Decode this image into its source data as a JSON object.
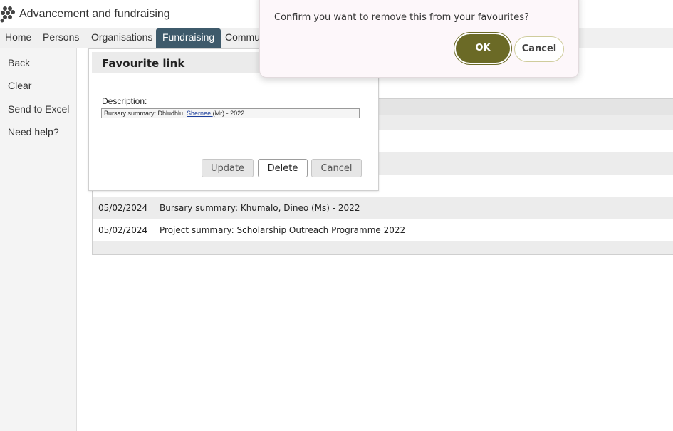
{
  "app": {
    "title": "Advancement and fundraising"
  },
  "nav": {
    "items": [
      "Home",
      "Persons",
      "Organisations",
      "Fundraising",
      "Commu"
    ],
    "active": "Fundraising"
  },
  "sidebar": {
    "items": [
      "Back",
      "Clear",
      "Send to Excel",
      "Need help?"
    ]
  },
  "favourites_table": {
    "rows": [
      {
        "date": "05/02/2024",
        "description": "Bursary summary: Khumalo, Dineo (Ms) - 2022"
      },
      {
        "date": "05/02/2024",
        "description": "Project summary: Scholarship Outreach Programme 2022"
      }
    ]
  },
  "fav_dialog": {
    "title": "Favourite link",
    "description_label": "Description:",
    "description_before": "Bursary summary: Dhludhlu, ",
    "description_link": "Shernee ",
    "description_after": "(Mr) - 2022",
    "buttons": {
      "update": "Update",
      "delete": "Delete",
      "cancel": "Cancel"
    }
  },
  "confirm_popup": {
    "message": "Confirm you want to remove this from your favourites?",
    "ok": "OK",
    "cancel": "Cancel"
  },
  "colors": {
    "nav_active": "#3e5a6b",
    "ok_button": "#6b6a26"
  }
}
